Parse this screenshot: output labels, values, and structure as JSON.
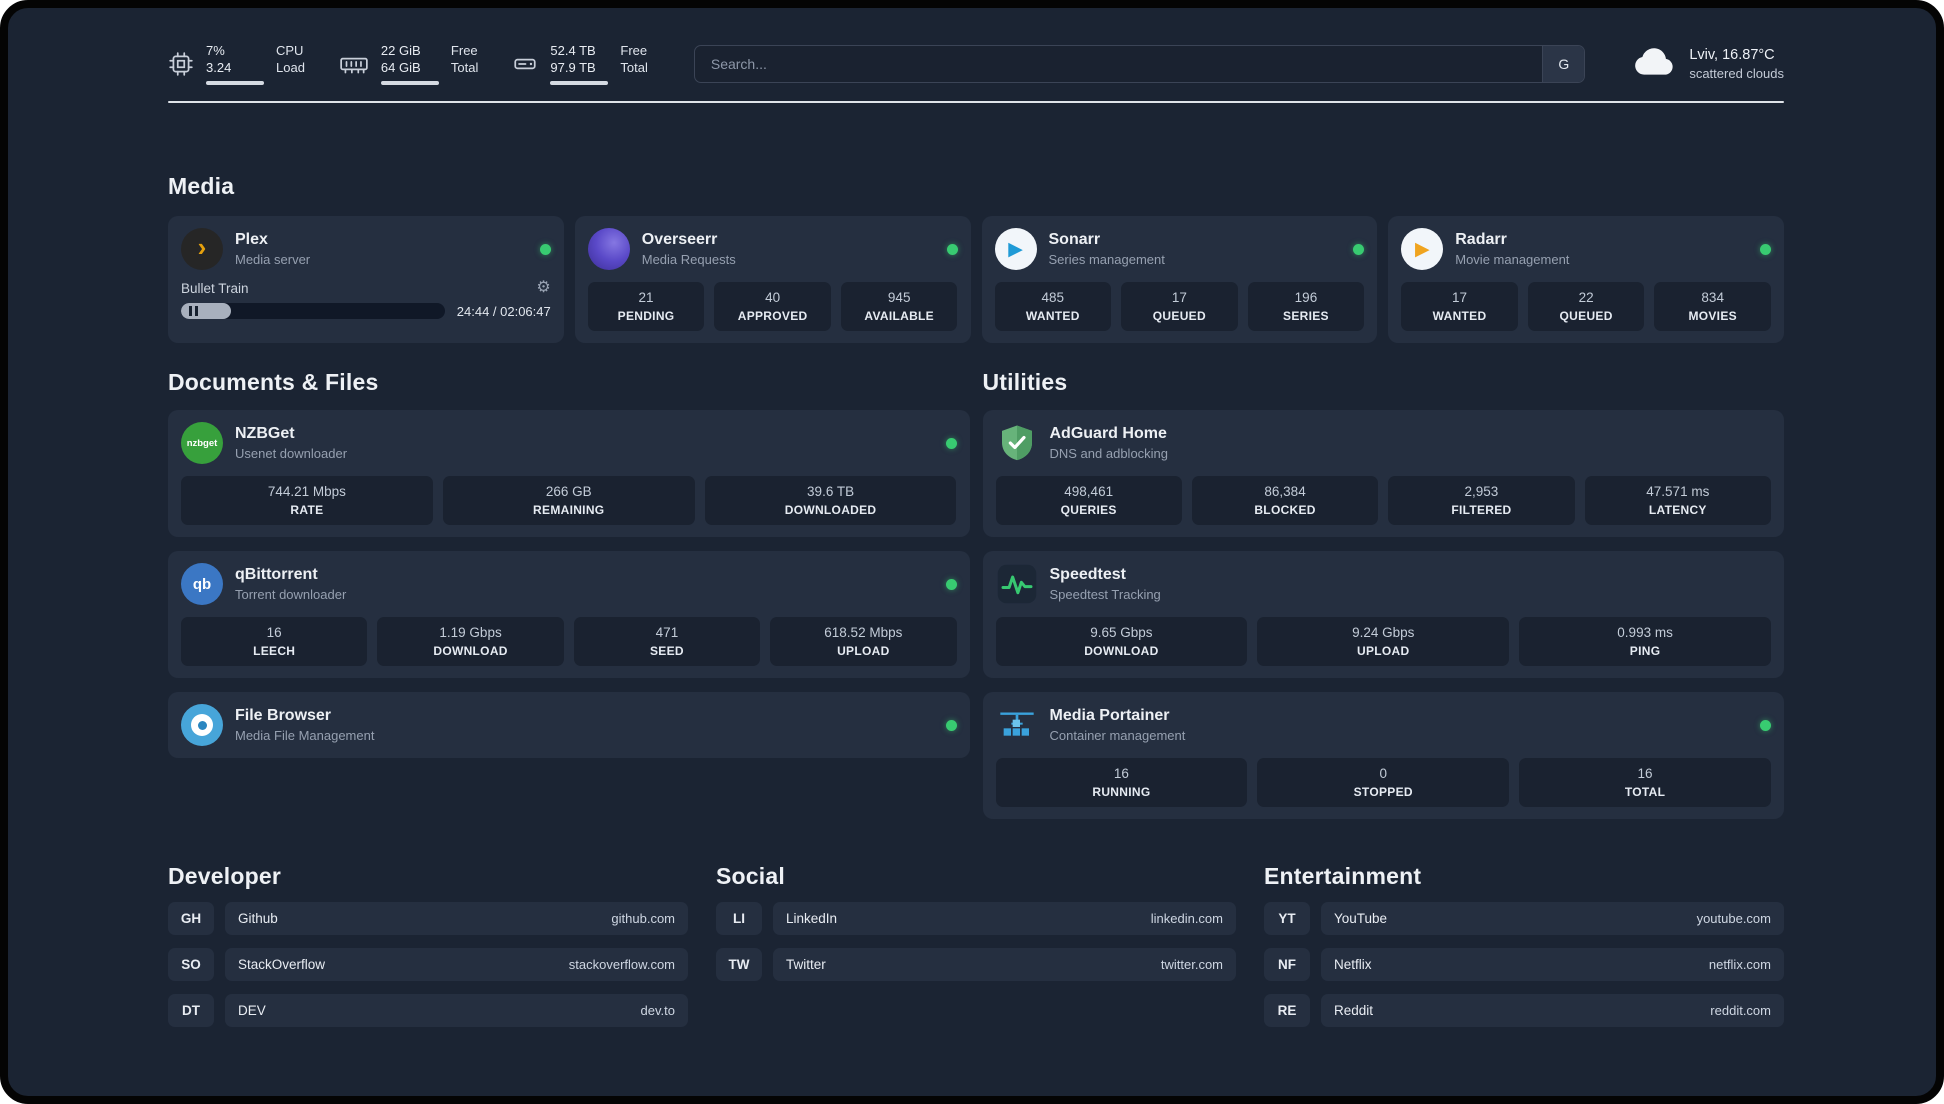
{
  "colors": {
    "background": "#1b2433",
    "card": "#252f40",
    "tile": "#1a2230",
    "accent_green": "#38cb71",
    "plex_amber": "#e5a00d"
  },
  "topbar": {
    "cpu": {
      "value_top": "7%",
      "value_bottom": "3.24",
      "label_top": "CPU",
      "label_bottom": "Load"
    },
    "memory": {
      "value_top": "22 GiB",
      "value_bottom": "64 GiB",
      "label_top": "Free",
      "label_bottom": "Total"
    },
    "disk": {
      "value_top": "52.4 TB",
      "value_bottom": "97.9 TB",
      "label_top": "Free",
      "label_bottom": "Total"
    },
    "search": {
      "placeholder": "Search...",
      "shortcut": "G"
    },
    "weather": {
      "location": "Lviv, 16.87°C",
      "condition": "scattered clouds"
    }
  },
  "icons": {
    "plex_glyph": "›",
    "play_glyph": "▶",
    "gear_glyph": "⚙",
    "nzbget_text": "nzbget",
    "qbittorrent_text": "qb"
  },
  "sections": {
    "media": {
      "title": "Media",
      "cards": [
        {
          "title": "Plex",
          "subtitle": "Media server",
          "online": true,
          "player": {
            "track": "Bullet Train",
            "time": "24:44 / 02:06:47",
            "progress_percent": 19
          }
        },
        {
          "title": "Overseerr",
          "subtitle": "Media Requests",
          "online": true,
          "stats": [
            {
              "value": "21",
              "label": "PENDING"
            },
            {
              "value": "40",
              "label": "APPROVED"
            },
            {
              "value": "945",
              "label": "AVAILABLE"
            }
          ]
        },
        {
          "title": "Sonarr",
          "subtitle": "Series management",
          "online": true,
          "stats": [
            {
              "value": "485",
              "label": "WANTED"
            },
            {
              "value": "17",
              "label": "QUEUED"
            },
            {
              "value": "196",
              "label": "SERIES"
            }
          ]
        },
        {
          "title": "Radarr",
          "subtitle": "Movie management",
          "online": true,
          "stats": [
            {
              "value": "17",
              "label": "WANTED"
            },
            {
              "value": "22",
              "label": "QUEUED"
            },
            {
              "value": "834",
              "label": "MOVIES"
            }
          ]
        }
      ]
    },
    "documents": {
      "title": "Documents & Files",
      "cards": [
        {
          "title": "NZBGet",
          "subtitle": "Usenet downloader",
          "online": true,
          "stats": [
            {
              "value": "744.21 Mbps",
              "label": "RATE"
            },
            {
              "value": "266 GB",
              "label": "REMAINING"
            },
            {
              "value": "39.6 TB",
              "label": "DOWNLOADED"
            }
          ]
        },
        {
          "title": "qBittorrent",
          "subtitle": "Torrent downloader",
          "online": true,
          "stats": [
            {
              "value": "16",
              "label": "LEECH"
            },
            {
              "value": "1.19 Gbps",
              "label": "DOWNLOAD"
            },
            {
              "value": "471",
              "label": "SEED"
            },
            {
              "value": "618.52 Mbps",
              "label": "UPLOAD"
            }
          ]
        },
        {
          "title": "File Browser",
          "subtitle": "Media File Management",
          "online": true
        }
      ]
    },
    "utilities": {
      "title": "Utilities",
      "cards": [
        {
          "title": "AdGuard Home",
          "subtitle": "DNS and adblocking",
          "stats": [
            {
              "value": "498,461",
              "label": "QUERIES"
            },
            {
              "value": "86,384",
              "label": "BLOCKED"
            },
            {
              "value": "2,953",
              "label": "FILTERED"
            },
            {
              "value": "47.571 ms",
              "label": "LATENCY"
            }
          ]
        },
        {
          "title": "Speedtest",
          "subtitle": "Speedtest Tracking",
          "stats": [
            {
              "value": "9.65 Gbps",
              "label": "DOWNLOAD"
            },
            {
              "value": "9.24 Gbps",
              "label": "UPLOAD"
            },
            {
              "value": "0.993 ms",
              "label": "PING"
            }
          ]
        },
        {
          "title": "Media Portainer",
          "subtitle": "Container management",
          "online": true,
          "stats": [
            {
              "value": "16",
              "label": "RUNNING"
            },
            {
              "value": "0",
              "label": "STOPPED"
            },
            {
              "value": "16",
              "label": "TOTAL"
            }
          ]
        }
      ]
    }
  },
  "bookmarks": [
    {
      "title": "Developer",
      "items": [
        {
          "abbr": "GH",
          "name": "Github",
          "domain": "github.com"
        },
        {
          "abbr": "SO",
          "name": "StackOverflow",
          "domain": "stackoverflow.com"
        },
        {
          "abbr": "DT",
          "name": "DEV",
          "domain": "dev.to"
        }
      ]
    },
    {
      "title": "Social",
      "items": [
        {
          "abbr": "LI",
          "name": "LinkedIn",
          "domain": "linkedin.com"
        },
        {
          "abbr": "TW",
          "name": "Twitter",
          "domain": "twitter.com"
        }
      ]
    },
    {
      "title": "Entertainment",
      "items": [
        {
          "abbr": "YT",
          "name": "YouTube",
          "domain": "youtube.com"
        },
        {
          "abbr": "NF",
          "name": "Netflix",
          "domain": "netflix.com"
        },
        {
          "abbr": "RE",
          "name": "Reddit",
          "domain": "reddit.com"
        }
      ]
    }
  ]
}
